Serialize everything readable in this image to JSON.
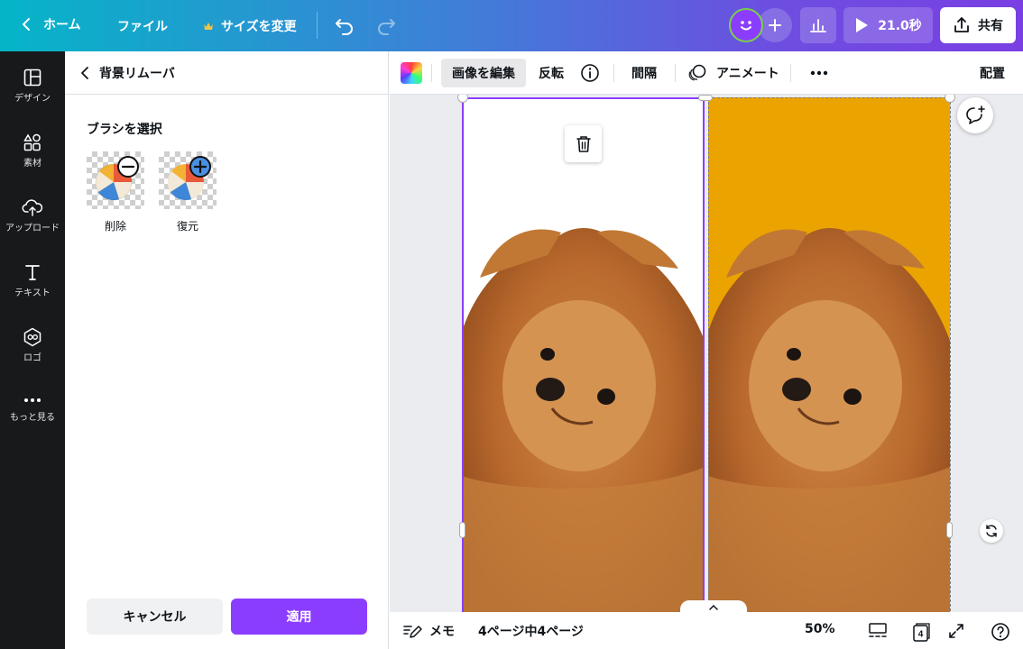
{
  "topbar": {
    "home_label": "ホーム",
    "file_label": "ファイル",
    "resize_label": "サイズを変更",
    "play_duration": "21.0秒",
    "share_label": "共有"
  },
  "rail": {
    "items": [
      {
        "label": "デザイン",
        "icon": "layout-icon"
      },
      {
        "label": "素材",
        "icon": "shapes-icon"
      },
      {
        "label": "アップロード",
        "icon": "cloud-upload-icon"
      },
      {
        "label": "テキスト",
        "icon": "text-icon"
      },
      {
        "label": "ロゴ",
        "icon": "logo-icon"
      },
      {
        "label": "もっと見る",
        "icon": "more-dots-icon"
      }
    ]
  },
  "panel": {
    "title": "背景リムーバ",
    "section_title": "ブラシを選択",
    "brushes": [
      {
        "label": "削除",
        "icon": "minus-icon"
      },
      {
        "label": "復元",
        "icon": "plus-icon"
      }
    ],
    "cancel_label": "キャンセル",
    "apply_label": "適用"
  },
  "context_toolbar": {
    "edit_image": "画像を編集",
    "flip": "反転",
    "spacing": "間隔",
    "animate": "アニメート",
    "position": "配置"
  },
  "bottom": {
    "notes_label": "メモ",
    "page_indicator": "4ページ中4ページ",
    "zoom": "50%",
    "page_count_badge": "4"
  },
  "colors": {
    "brand_purple": "#8b3dff",
    "right_page_bg": "#eba300",
    "rail_bg": "#18191b"
  }
}
